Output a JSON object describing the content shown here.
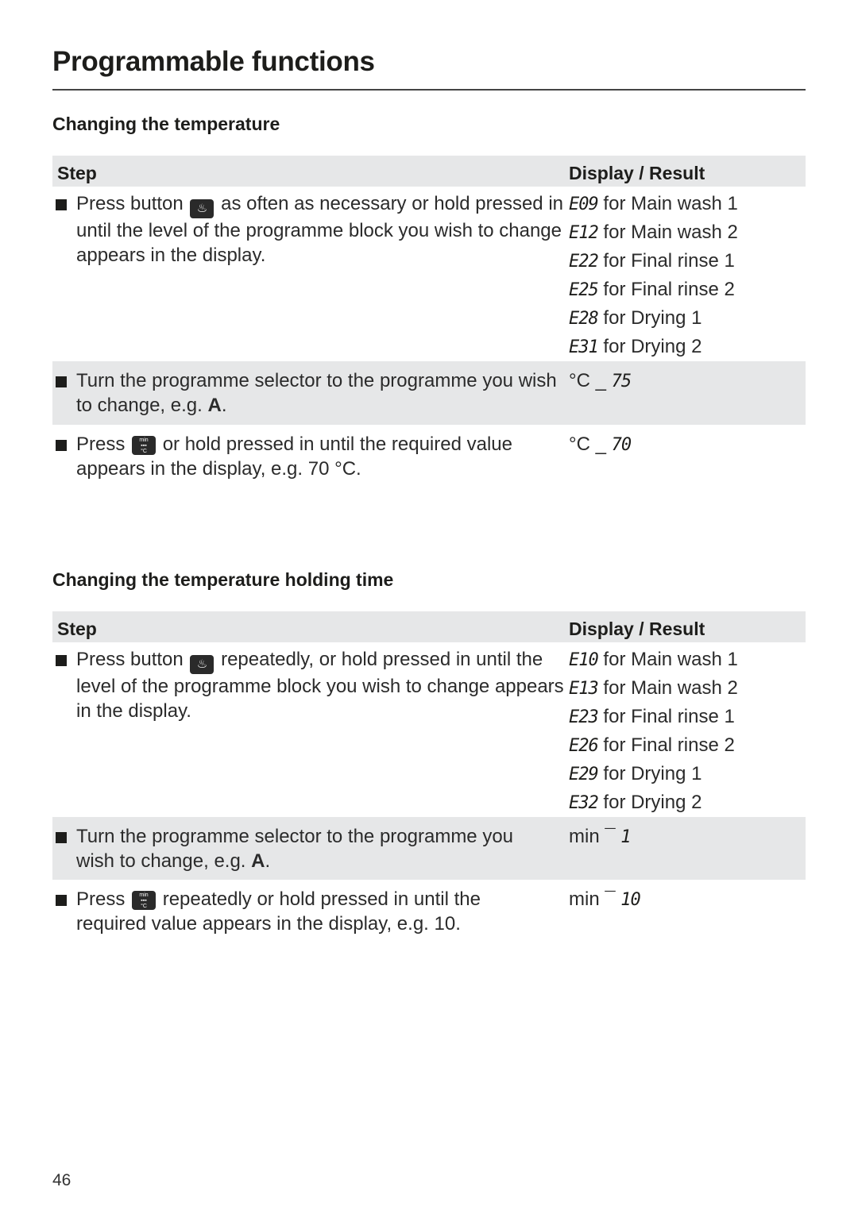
{
  "page": {
    "title": "Programmable functions",
    "page_number": "46"
  },
  "sections": [
    {
      "heading": "Changing the temperature",
      "header": {
        "step": "Step",
        "result": "Display / Result"
      },
      "rows": [
        {
          "step_before_icon": "Press button",
          "icon": "heat-holding-button-icon",
          "step_after_icon": "as often as necessary or hold pressed in until the level of the programme block you wish to change appears in the display.",
          "results": [
            {
              "code": "E09",
              "text": "for Main wash 1"
            },
            {
              "code": "E12",
              "text": "for Main wash 2"
            },
            {
              "code": "E22",
              "text": "for Final rinse 1"
            },
            {
              "code": "E25",
              "text": "for Final rinse 2"
            },
            {
              "code": "E28",
              "text": "for Drying 1"
            },
            {
              "code": "E31",
              "text": "for Drying 2"
            }
          ]
        },
        {
          "step_text": "Turn the programme selector to the programme you wish to change, e.g.",
          "step_bold": "A",
          "step_end": ".",
          "result_prefix": "°C _",
          "result_value": "75"
        },
        {
          "step_before_icon": "Press",
          "icon": "min-celsius-button-icon",
          "step_after_icon": "or hold pressed in until the required value appears in the display, e.g. 70 °C.",
          "result_prefix": "°C _",
          "result_value": "70"
        }
      ]
    },
    {
      "heading": "Changing the temperature holding time",
      "header": {
        "step": "Step",
        "result": "Display / Result"
      },
      "rows": [
        {
          "step_before_icon": "Press button",
          "icon": "heat-holding-button-icon",
          "step_after_icon": "repeatedly, or hold pressed in until the level of the programme block you wish to change appears in the display.",
          "results": [
            {
              "code": "E10",
              "text": "for Main wash 1"
            },
            {
              "code": "E13",
              "text": "for Main wash 2"
            },
            {
              "code": "E23",
              "text": "for Final rinse 1"
            },
            {
              "code": "E26",
              "text": "for Final rinse 2"
            },
            {
              "code": "E29",
              "text": "for Drying 1"
            },
            {
              "code": "E32",
              "text": "for Drying 2"
            }
          ]
        },
        {
          "step_text": "Turn the programme selector to the programme you wish to change, e.g.",
          "step_bold": "A",
          "step_end": ".",
          "result_prefix": "min ¯",
          "result_value": "1"
        },
        {
          "step_before_icon": "Press",
          "icon": "min-celsius-button-icon",
          "step_after_icon": "repeatedly or hold pressed in until the required value appears in the display, e.g. 10.",
          "result_prefix": "min ¯",
          "result_value": "10"
        }
      ]
    }
  ],
  "icons": {
    "heat_glyph": "♨",
    "minc_glyph_top": "min",
    "minc_glyph_bottom": "°C"
  }
}
